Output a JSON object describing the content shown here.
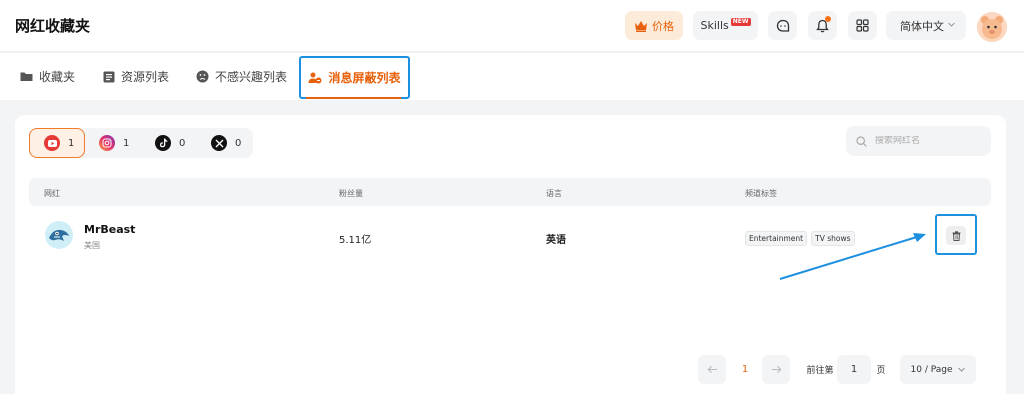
{
  "app": {
    "title": "网红收藏夹"
  },
  "header": {
    "price_label": "价格",
    "skills_label": "Skills",
    "skills_badge": "NEW",
    "language": "简体中文",
    "icons": [
      "crown-icon",
      "chat-icon",
      "bell-icon",
      "apps-grid-icon",
      "chevron-down-icon",
      "user-avatar"
    ],
    "colors": {
      "accent": "#e8610c",
      "price_bg": "#fdebd9",
      "notify_dot": "#f97316"
    }
  },
  "tabs": [
    {
      "label": "收藏夹",
      "icon": "folder-icon"
    },
    {
      "label": "资源列表",
      "icon": "list-icon"
    },
    {
      "label": "不感兴趣列表",
      "icon": "sad-face-icon"
    },
    {
      "label": "消息屏蔽列表",
      "icon": "users-block-icon",
      "active": true
    }
  ],
  "platforms": [
    {
      "name": "youtube-icon",
      "count": "1",
      "active": true
    },
    {
      "name": "instagram-icon",
      "count": "1"
    },
    {
      "name": "tiktok-icon",
      "count": "0"
    },
    {
      "name": "x-icon",
      "count": "0"
    }
  ],
  "search": {
    "placeholder": "搜索网红名"
  },
  "table": {
    "headers": [
      "网红",
      "粉丝量",
      "语言",
      "频道标签"
    ],
    "rows": [
      {
        "name": "MrBeast",
        "country": "美国",
        "fans": "5.11亿",
        "language": "英语",
        "tags": [
          "Entertainment",
          "TV shows"
        ]
      }
    ]
  },
  "pagination": {
    "current": "1",
    "goto_label": "前往第",
    "goto_value": "1",
    "page_unit": "页",
    "page_size": "10 / Page"
  },
  "annotation_color": "#1e90e0"
}
